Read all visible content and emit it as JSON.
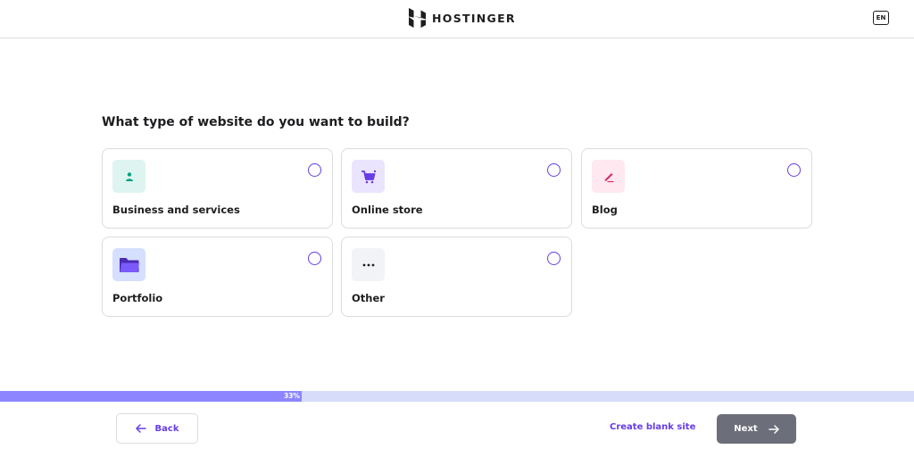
{
  "header": {
    "brand": "HOSTINGER",
    "logo_icon": "hostinger-logo-icon",
    "language": "EN"
  },
  "question": "What type of website do you want to build?",
  "options": [
    {
      "label": "Business and services",
      "icon": "person-icon",
      "tile_color": "#def4f0",
      "icon_color": "#00b090",
      "selected": false
    },
    {
      "label": "Online store",
      "icon": "shopping-cart-icon",
      "tile_color": "#ebe4ff",
      "icon_color": "#673de6",
      "selected": false
    },
    {
      "label": "Blog",
      "icon": "pen-icon",
      "tile_color": "#ffe8ef",
      "icon_color": "#d63163",
      "selected": false
    },
    {
      "label": "Portfolio",
      "icon": "folder-icon",
      "tile_color": "#d5dfff",
      "icon_color": "#673de6",
      "selected": false
    },
    {
      "label": "Other",
      "icon": "more-dots-icon",
      "tile_color": "#f2f3f6",
      "icon_color": "#1d1e20",
      "selected": false
    }
  ],
  "progress": {
    "percent": 33,
    "label": "33%"
  },
  "footer": {
    "back_label": "Back",
    "blank_label": "Create blank site",
    "next_label": "Next"
  },
  "colors": {
    "accent": "#673de6",
    "next_button": "#6c6e79",
    "progress_track": "#d6dcf9",
    "progress_fill": "#8c85ff"
  }
}
